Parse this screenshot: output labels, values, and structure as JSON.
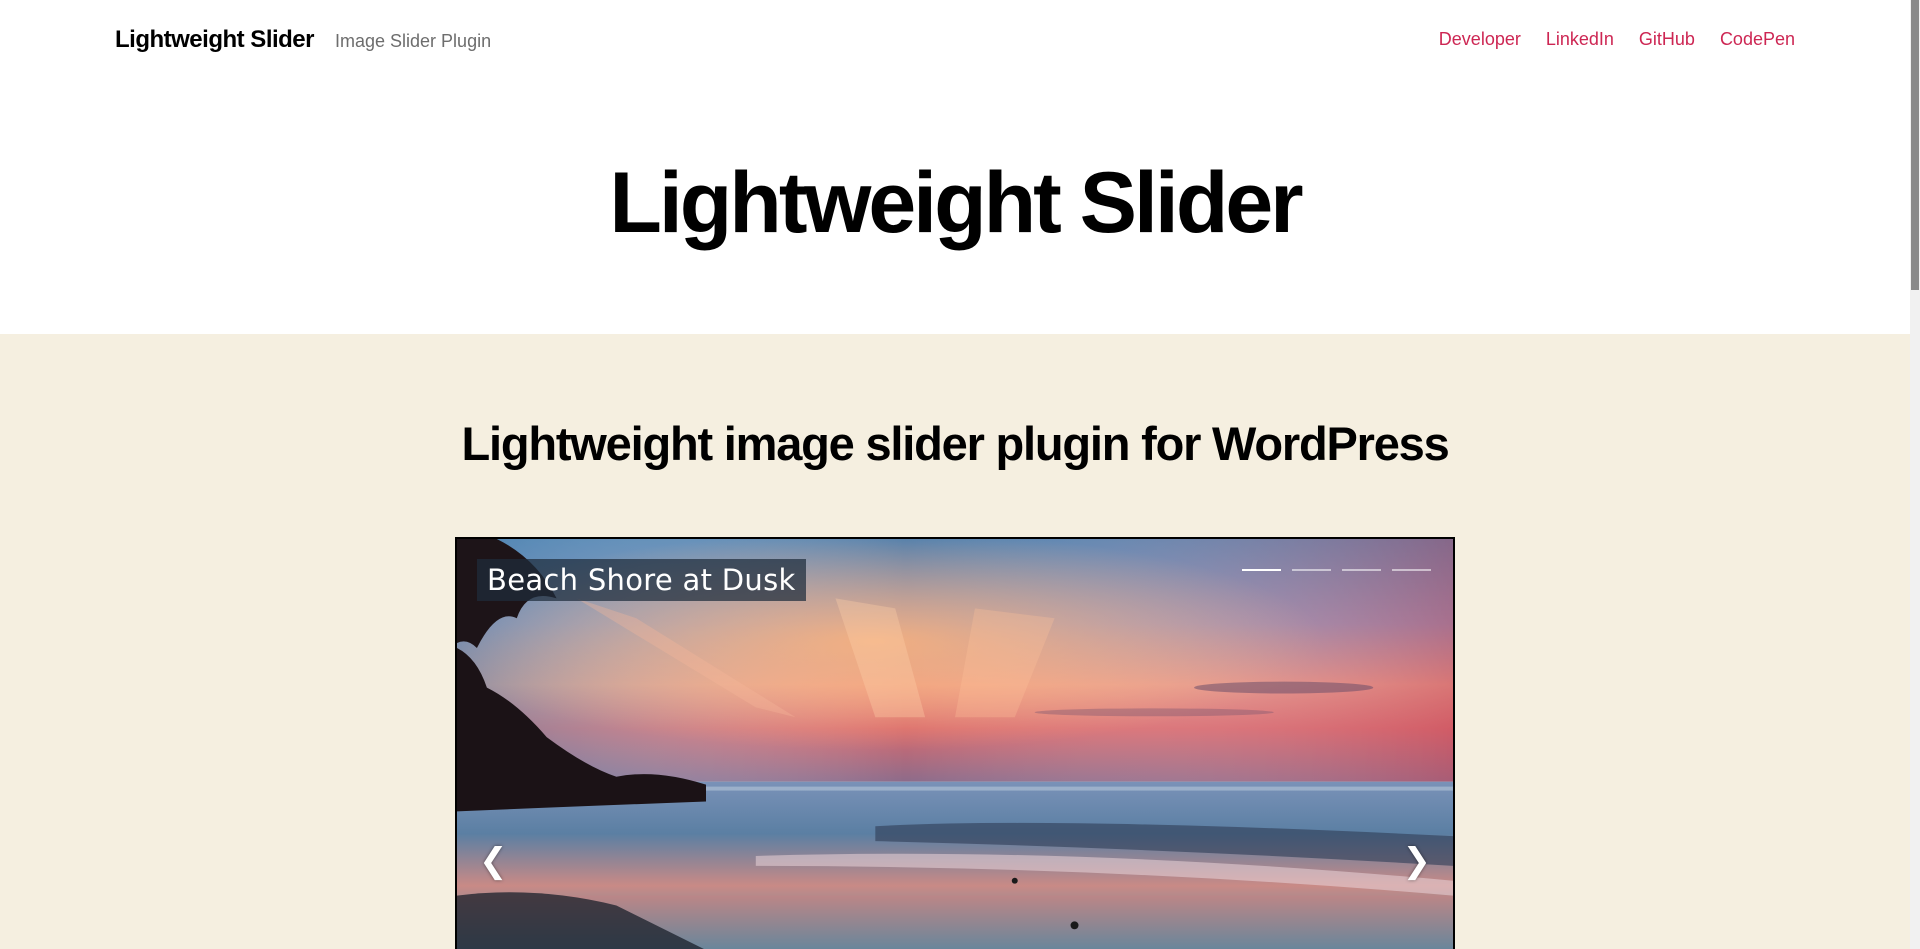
{
  "header": {
    "site_title": "Lightweight Slider",
    "site_description": "Image Slider Plugin",
    "nav": [
      "Developer",
      "LinkedIn",
      "GitHub",
      "CodePen"
    ]
  },
  "hero": {
    "title": "Lightweight Slider"
  },
  "main": {
    "section_title": "Lightweight image slider plugin for WordPress",
    "slider": {
      "caption": "Beach Shore at Dusk",
      "slide_count": 4,
      "active_slide": 1,
      "prev_icon": "chevron-left-icon",
      "next_icon": "chevron-right-icon",
      "prev_glyph": "❮",
      "next_glyph": "❯"
    }
  },
  "colors": {
    "link": "#cd2653",
    "content_background": "#f5efe0",
    "text": "#000000",
    "muted": "#6d6d6d"
  }
}
